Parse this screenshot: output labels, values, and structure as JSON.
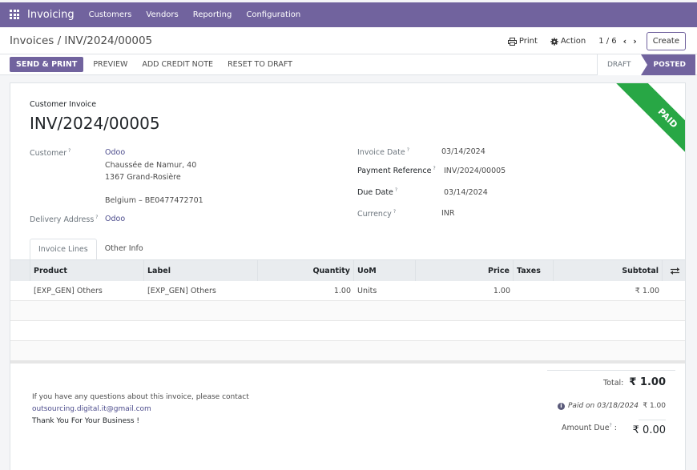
{
  "navbar": {
    "app_name": "Invoicing",
    "menus": [
      "Customers",
      "Vendors",
      "Reporting",
      "Configuration"
    ]
  },
  "control_panel": {
    "breadcrumb": "Invoices / INV/2024/00005",
    "print_label": "Print",
    "action_label": "Action",
    "pager": "1 / 6",
    "create_label": "Create"
  },
  "buttons": {
    "send_print": "SEND & PRINT",
    "preview": "PREVIEW",
    "add_credit_note": "ADD CREDIT NOTE",
    "reset_to_draft": "RESET TO DRAFT"
  },
  "status": {
    "stages": [
      "DRAFT",
      "POSTED"
    ],
    "current": "POSTED"
  },
  "ribbon": {
    "text": "PAID",
    "color": "#28a745"
  },
  "invoice": {
    "type": "Customer Invoice",
    "name": "INV/2024/00005",
    "customer_label": "Customer",
    "customer_name": "Odoo",
    "customer_address": [
      "Chaussée de Namur, 40",
      "1367 Grand-Rosière",
      "",
      "Belgium – BE0477472701"
    ],
    "delivery_label": "Delivery Address",
    "delivery_value": "Odoo",
    "invoice_date_label": "Invoice Date",
    "invoice_date": "03/14/2024",
    "payment_ref_label": "Payment Reference",
    "payment_ref": "INV/2024/00005",
    "due_date_label": "Due Date",
    "due_date": "03/14/2024",
    "currency_label": "Currency",
    "currency": "INR",
    "help_mark": "?"
  },
  "tabs": [
    {
      "label": "Invoice Lines",
      "active": true
    },
    {
      "label": "Other Info",
      "active": false
    }
  ],
  "lines": {
    "columns": [
      "Product",
      "Label",
      "Quantity",
      "UoM",
      "Price",
      "Taxes",
      "Subtotal"
    ],
    "rows": [
      {
        "product": "[EXP_GEN] Others",
        "label": "[EXP_GEN] Others",
        "quantity": "1.00",
        "uom": "Units",
        "price": "1.00",
        "taxes": "",
        "subtotal": "₹ 1.00"
      }
    ]
  },
  "terms": {
    "line1": "If you have any questions about this invoice, please contact",
    "email": "outsourcing.digital.it@gmail.com",
    "thanks": "Thank You For Your Business !"
  },
  "totals": {
    "total_label": "Total:",
    "total_value": "₹ 1.00",
    "paid_text": "Paid on 03/18/2024",
    "paid_amount": "₹ 1.00",
    "amount_due_label": "Amount Due",
    "amount_due_value": "₹ 0.00"
  },
  "colors": {
    "brand": "#71639e",
    "paid": "#28a745"
  }
}
